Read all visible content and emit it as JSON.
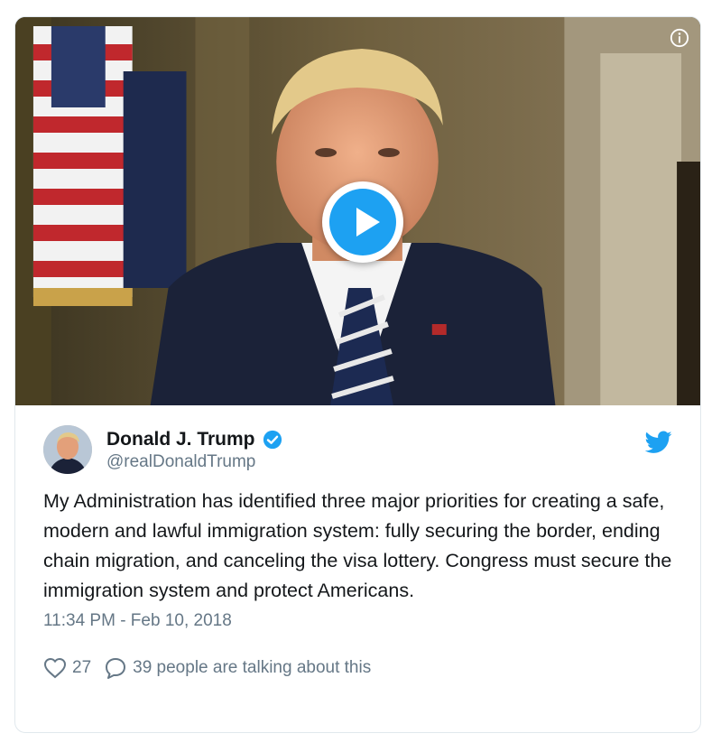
{
  "tweet": {
    "display_name": "Donald J. Trump",
    "handle": "@realDonaldTrump",
    "text": "My Administration has identified three major priorities for creating a safe, modern and lawful immigration system: fully securing the border, ending chain migration, and canceling the visa lottery. Congress must secure the immigration system and protect Americans.",
    "timestamp": "11:34 PM - Feb 10, 2018",
    "like_count": "27",
    "talking_text": "39 people are talking about this"
  },
  "media": {
    "type": "video",
    "play_button_icon": "play-icon",
    "info_icon": "info-icon"
  },
  "icons": {
    "verified": "verified-badge-icon",
    "bird": "twitter-bird-icon",
    "like": "heart-icon",
    "reply": "speech-bubble-icon"
  },
  "colors": {
    "accent": "#1da1f2",
    "text_primary": "#14171a",
    "text_secondary": "#657786",
    "border": "#e1e8ed"
  }
}
